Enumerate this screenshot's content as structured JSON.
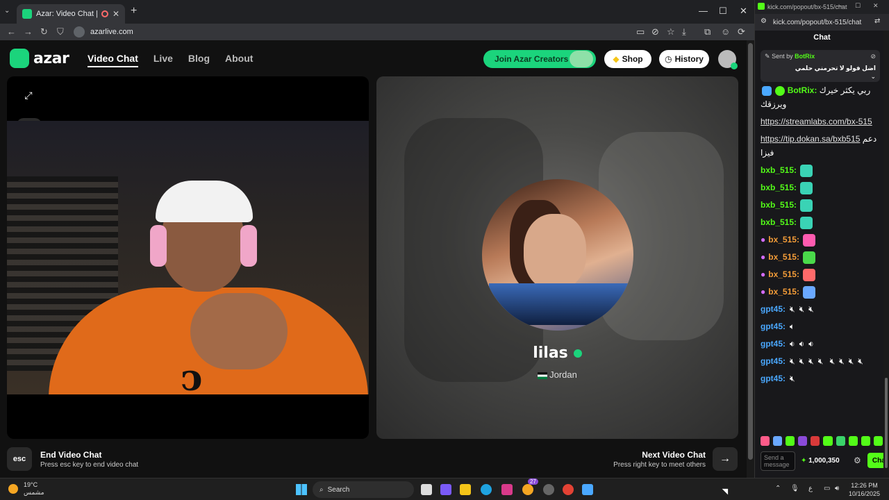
{
  "browser": {
    "tab_title": "Azar: Video Chat | Alternati",
    "url": "azarlive.com"
  },
  "azar": {
    "logo_text": "azar",
    "nav": [
      "Video Chat",
      "Live",
      "Blog",
      "About"
    ],
    "join_label": "Join Azar Creators",
    "shop_label": "Shop",
    "history_label": "History",
    "partner": {
      "name": "lilas",
      "country": "Jordan"
    },
    "footer": {
      "esc_key": "esc",
      "end_title": "End Video Chat",
      "end_sub": "Press esc key to end video chat",
      "next_title": "Next Video Chat",
      "next_sub": "Press right key to meet others"
    }
  },
  "chat": {
    "window_url": "kick.com/popout/bx-515/chat",
    "page_url": "kick.com/popout/bx-515/chat",
    "header": "Chat",
    "pinned_by_prefix": "Sent by",
    "pinned_by_user": "BotRix",
    "pinned_message": "اضل فولو لا تحرمني حلمي",
    "messages": [
      {
        "user": "BotRix",
        "text": "ربي يكثر خيرك ويرزقك"
      },
      {
        "user": "",
        "link": "https://streamlabs.com/bx-515"
      },
      {
        "user": "",
        "link": "https://tip.dokan.sa/bxb515",
        "suffix": "دعم فيزا"
      },
      {
        "user": "bxb_515"
      },
      {
        "user": "bxb_515"
      },
      {
        "user": "bxb_515"
      },
      {
        "user": "bxb_515"
      },
      {
        "user": "bx_515"
      },
      {
        "user": "bx_515"
      },
      {
        "user": "bx_515"
      },
      {
        "user": "bx_515"
      },
      {
        "user": "gpt45"
      },
      {
        "user": "gpt45"
      },
      {
        "user": "gpt45"
      },
      {
        "user": "gpt45"
      },
      {
        "user": "gpt45"
      }
    ],
    "input_placeholder": "Send a message",
    "points": "1,000,350",
    "send_label": "Chat"
  },
  "taskbar": {
    "temperature": "19°C",
    "weather_desc": "مشمس",
    "search_label": "Search",
    "badge_count": "27",
    "time": "12:26 PM",
    "date": "10/16/2025",
    "lang": "ع"
  },
  "colors": {
    "azar_green": "#1bd47c",
    "kick_green": "#53fc18",
    "shirt_orange": "#e06a1a"
  }
}
